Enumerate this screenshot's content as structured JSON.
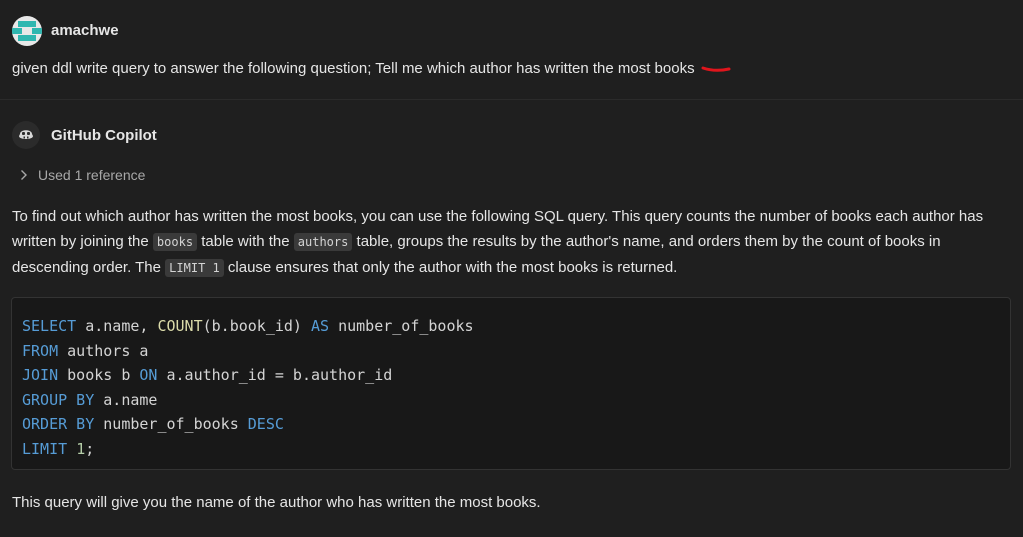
{
  "user_message": {
    "username": "amachwe",
    "text": "given ddl write query to answer the following question; Tell me which author has written the most books"
  },
  "assistant": {
    "name": "GitHub Copilot",
    "references_label": "Used 1 reference",
    "intro": {
      "part1": "To find out which author has written the most books, you can use the following SQL query. This query counts the number of books each author has written by joining the ",
      "code1": "books",
      "part2": " table with the ",
      "code2": "authors",
      "part3": " table, groups the results by the author's name, and orders them by the count of books in descending order. The ",
      "code3": "LIMIT 1",
      "part4": " clause ensures that only the author with the most books is returned."
    },
    "code": {
      "l1_kw1": "SELECT",
      "l1_t1": " a.name, ",
      "l1_fn": "COUNT",
      "l1_t2": "(b.book_id) ",
      "l1_kw2": "AS",
      "l1_t3": " number_of_books",
      "l2_kw": "FROM",
      "l2_t": " authors a",
      "l3_kw1": "JOIN",
      "l3_t1": " books b ",
      "l3_kw2": "ON",
      "l3_t2": " a.author_id = b.author_id",
      "l4_kw": "GROUP BY",
      "l4_t": " a.name",
      "l5_kw1": "ORDER BY",
      "l5_t": " number_of_books ",
      "l5_kw2": "DESC",
      "l6_kw": "LIMIT",
      "l6_num": "1",
      "l6_t": ";"
    },
    "outro": "This query will give you the name of the author who has written the most books."
  },
  "colors": {
    "background": "#1f1f1f",
    "keyword": "#569cd6",
    "function": "#dcdcaa",
    "number": "#b5cea8",
    "avatar_accent": "#2fb7b0",
    "annotation_red": "#e0151c"
  },
  "icons": {
    "user_avatar": "identicon-avatar",
    "assistant_avatar": "copilot-icon",
    "references_toggle": "chevron-right-icon"
  }
}
